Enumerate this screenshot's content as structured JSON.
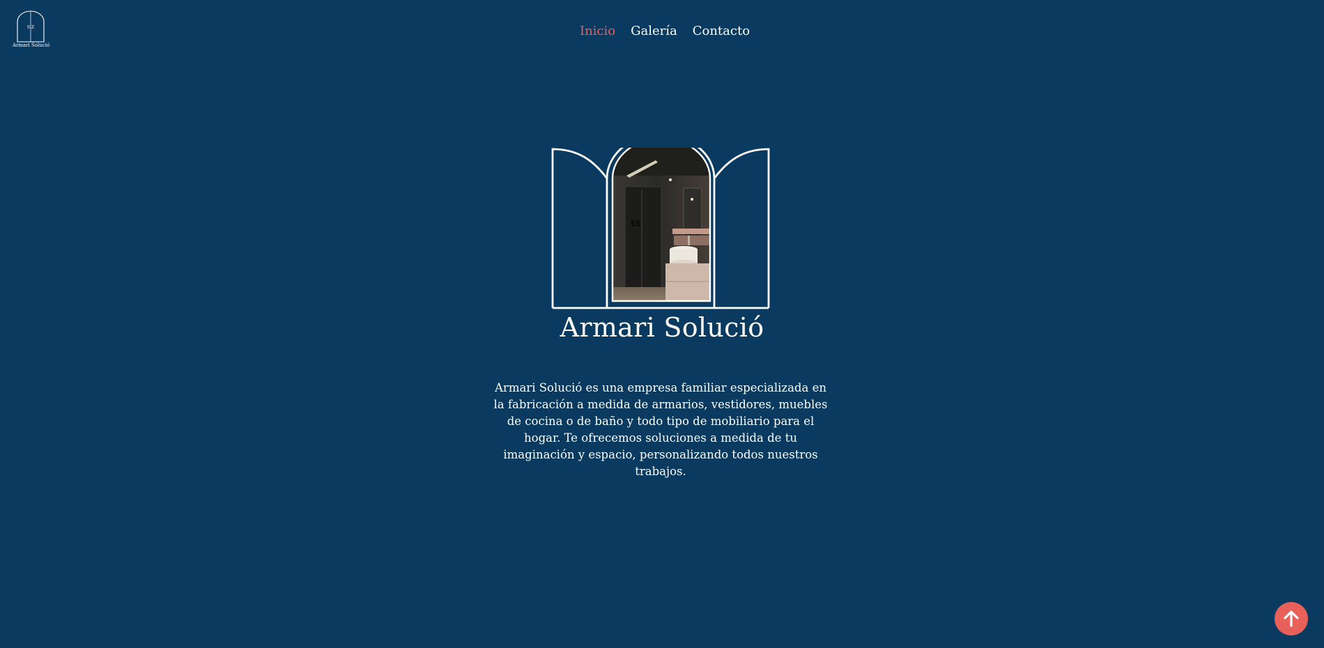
{
  "brand": {
    "logo_monogram": "S Z",
    "logo_caption": "Armari Solució",
    "title": "Armari Solució"
  },
  "nav": {
    "items": [
      {
        "label": "Inicio",
        "active": true
      },
      {
        "label": "Galería",
        "active": false
      },
      {
        "label": "Contacto",
        "active": false
      }
    ]
  },
  "intro": {
    "text": "Armari Solució es una empresa familiar especializada en la fabricación a medida de armarios, vestidores, muebles de cocina o de baño y todo tipo de mobiliario para el hogar. Te ofrecemos soluciones a medida de tu imaginación y espacio, personalizando todos nuestros trabajos."
  },
  "icons": {
    "scroll_top": "arrow-up-icon",
    "hero": "arched-window-illustration"
  },
  "colors": {
    "background": "#0a3a60",
    "accent": "#e8605a",
    "text": "#ffffff"
  }
}
